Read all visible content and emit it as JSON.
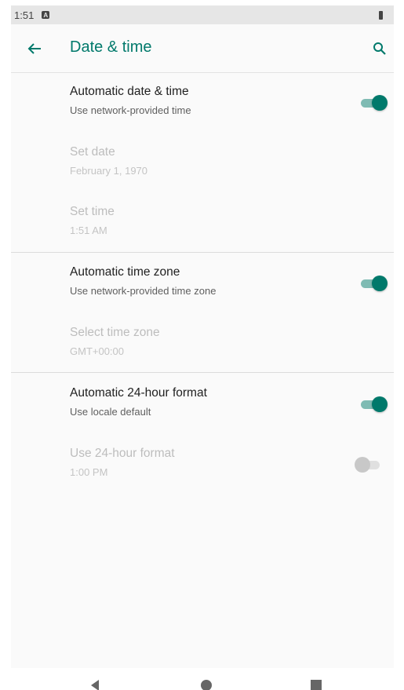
{
  "status_bar": {
    "time": "1:51",
    "notification_icon": "A"
  },
  "app_bar": {
    "title": "Date & time",
    "back_icon": "arrow-left",
    "search_icon": "magnifier",
    "accent_color": "#00796b"
  },
  "preferences": [
    {
      "title": "Automatic date & time",
      "summary": "Use network-provided time",
      "enabled": true,
      "switch": "on"
    },
    {
      "title": "Set date",
      "summary": "February 1, 1970",
      "enabled": false
    },
    {
      "title": "Set time",
      "summary": "1:51 AM",
      "enabled": false
    },
    {
      "title": "Automatic time zone",
      "summary": "Use network-provided time zone",
      "enabled": true,
      "switch": "on"
    },
    {
      "title": "Select time zone",
      "summary": "GMT+00:00",
      "enabled": false
    },
    {
      "title": "Automatic 24-hour format",
      "summary": "Use locale default",
      "enabled": true,
      "switch": "on"
    },
    {
      "title": "Use 24-hour format",
      "summary": "1:00 PM",
      "enabled": false,
      "switch": "off"
    }
  ],
  "nav_bar": {
    "back_icon": "triangle-back",
    "home_icon": "circle-home",
    "recents_icon": "square-recents"
  }
}
